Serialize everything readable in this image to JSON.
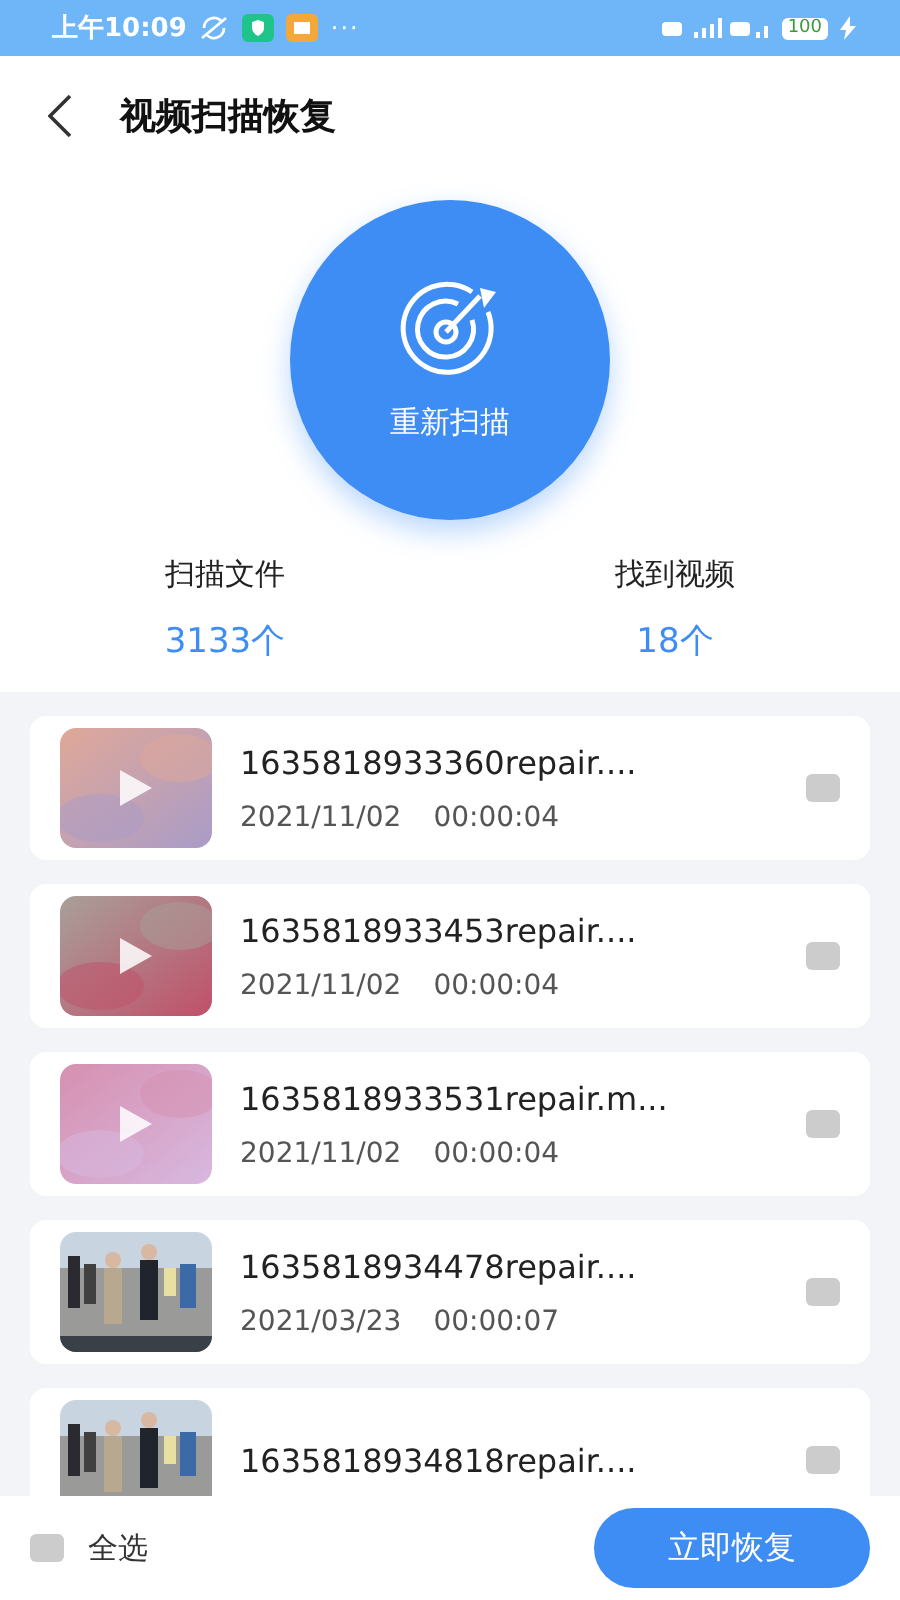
{
  "status_bar": {
    "time": "上午10:09",
    "more": "···",
    "battery": "100"
  },
  "header": {
    "title": "视频扫描恢复"
  },
  "scan_button": {
    "label": "重新扫描"
  },
  "stats": [
    {
      "label": "扫描文件",
      "value": "3133个"
    },
    {
      "label": "找到视频",
      "value": "18个"
    }
  ],
  "videos": [
    {
      "name": "1635818933360repair....",
      "date": "2021/11/02",
      "duration": "00:00:04",
      "checked": false
    },
    {
      "name": "1635818933453repair....",
      "date": "2021/11/02",
      "duration": "00:00:04",
      "checked": false
    },
    {
      "name": "1635818933531repair.m...",
      "date": "2021/11/02",
      "duration": "00:00:04",
      "checked": false
    },
    {
      "name": "1635818934478repair....",
      "date": "2021/03/23",
      "duration": "00:00:07",
      "checked": false
    },
    {
      "name": "1635818934818repair....",
      "checked": false
    }
  ],
  "footer": {
    "select_all": {
      "label": "全选",
      "checked": false
    },
    "restore_button": "立即恢复"
  }
}
